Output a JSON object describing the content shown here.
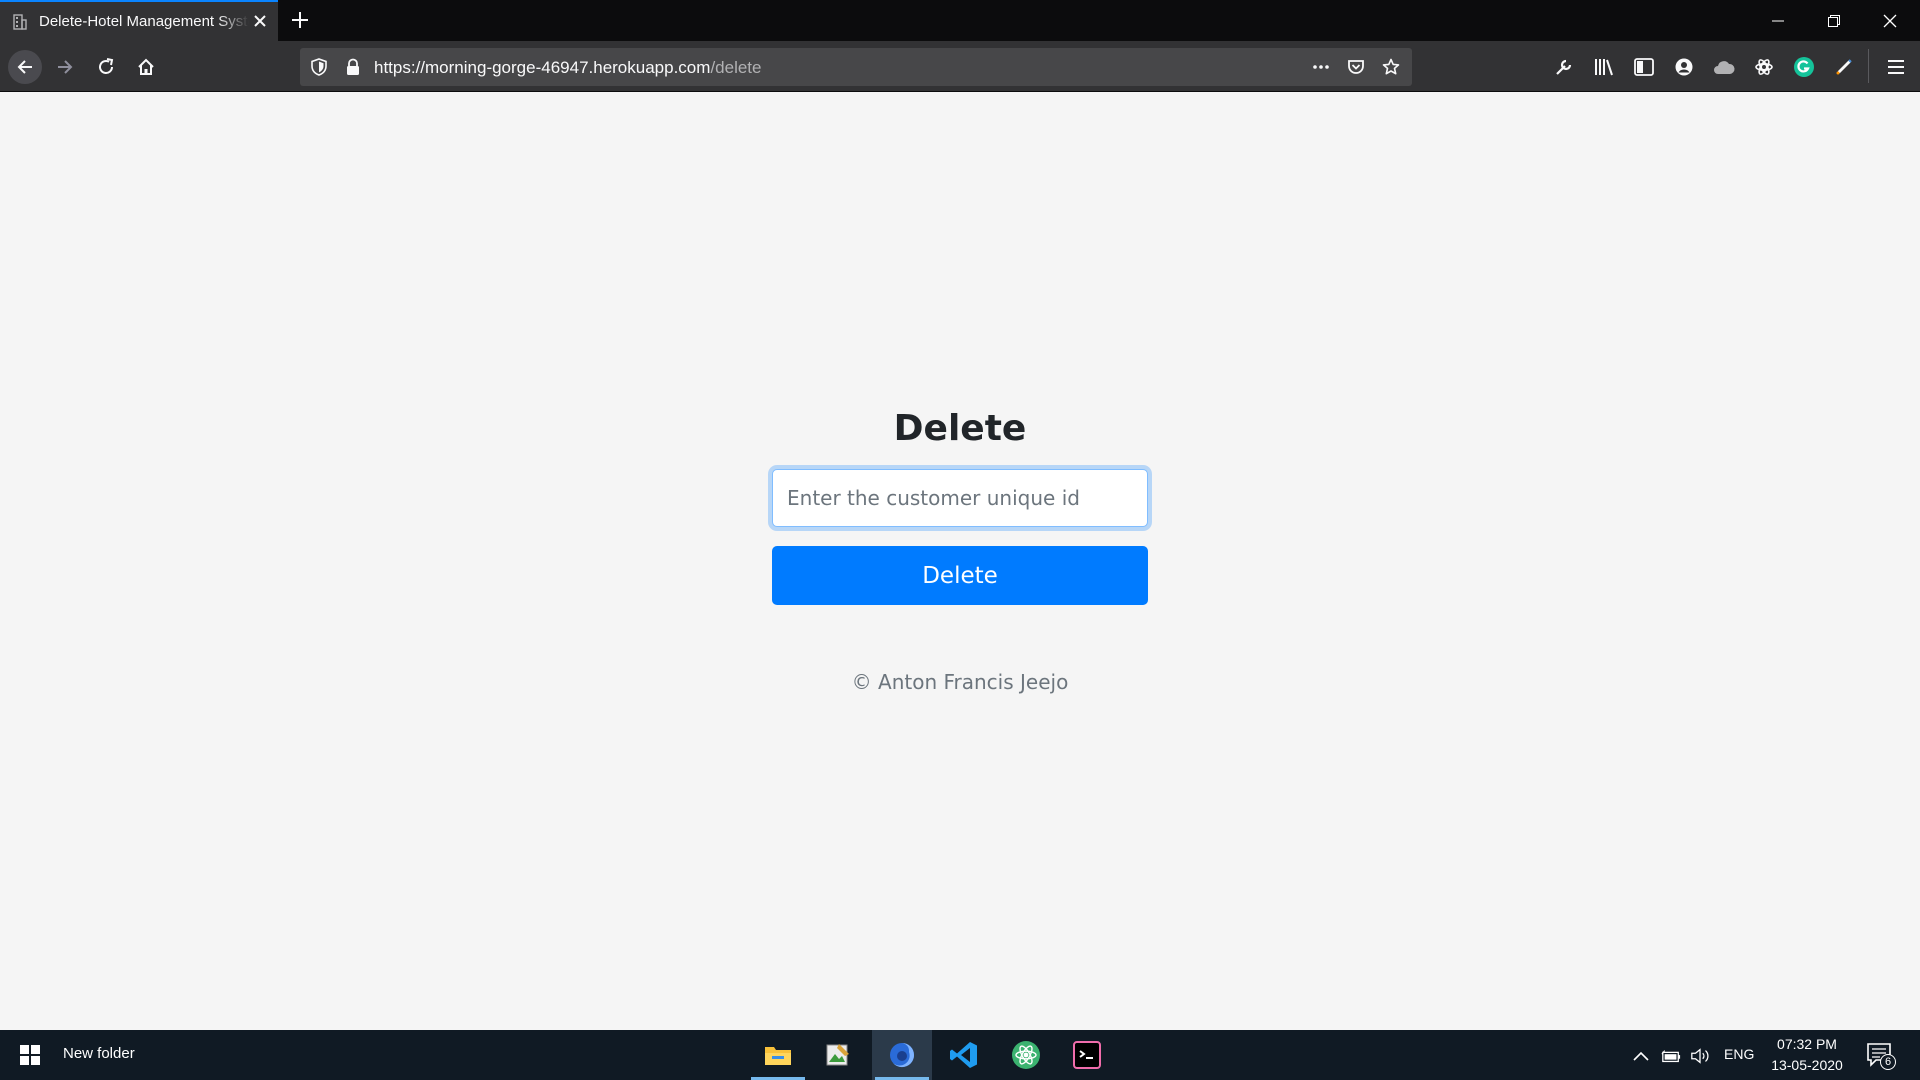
{
  "browser": {
    "tab_title": "Delete-Hotel Management System",
    "url_base": "https://morning-gorge-46947.herokuapp.com",
    "url_path": "/delete"
  },
  "page": {
    "heading": "Delete",
    "input_placeholder": "Enter the customer unique id",
    "button_label": "Delete",
    "footer": "© Anton Francis Jeejo"
  },
  "taskbar": {
    "folder_label": "New folder",
    "language": "ENG",
    "time": "07:32 PM",
    "date": "13-05-2020",
    "notification_count": "6"
  },
  "colors": {
    "accent": "#007bff",
    "page_bg": "#f5f5f5",
    "chrome_bg": "#323234",
    "taskbar_bg": "#101a24"
  },
  "icons": [
    "building-icon",
    "close-icon",
    "plus-icon",
    "minimize-icon",
    "restore-icon",
    "back-arrow-icon",
    "forward-arrow-icon",
    "reload-icon",
    "home-icon",
    "shield-icon",
    "lock-icon",
    "more-icon",
    "pocket-icon",
    "star-icon",
    "wrench-icon",
    "library-icon",
    "sidebar-icon",
    "account-icon",
    "cloud-icon",
    "settings-gear-icon",
    "grammarly-icon",
    "pen-icon",
    "hamburger-menu-icon",
    "windows-start-icon",
    "file-explorer-icon",
    "image-app-icon",
    "firefox-icon",
    "vscode-icon",
    "atom-icon",
    "terminal-icon",
    "chevron-up-icon",
    "battery-icon",
    "volume-icon",
    "notification-icon"
  ]
}
